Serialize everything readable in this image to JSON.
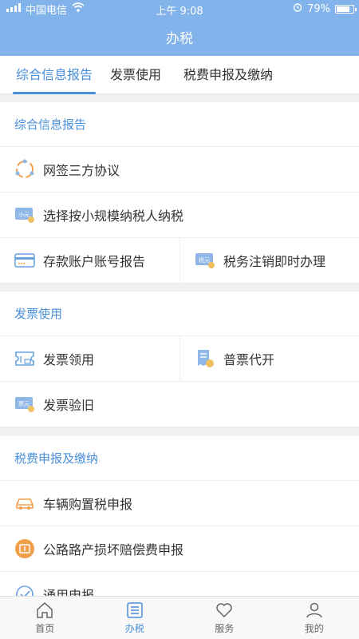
{
  "status_bar": {
    "carrier": "中国电信",
    "time": "上午 9:08",
    "battery": "79%"
  },
  "header": {
    "title": "办税"
  },
  "tabs": [
    {
      "label": "综合信息报告",
      "active": true
    },
    {
      "label": "发票使用",
      "active": false
    },
    {
      "label": "税费申报及缴纳",
      "active": false
    }
  ],
  "sections": {
    "info_report": {
      "title": "综合信息报告",
      "items": {
        "online_agreement": "网签三方协议",
        "small_scale": "选择按小规模纳税人纳税",
        "account_report": "存款账户账号报告",
        "tax_cancel": "税务注销即时办理"
      }
    },
    "invoice": {
      "title": "发票使用",
      "items": {
        "invoice_claim": "发票领用",
        "invoice_issue": "普票代开",
        "invoice_check": "发票验旧"
      }
    },
    "declare": {
      "title": "税费申报及缴纳",
      "items": {
        "vehicle_tax": "车辆购置税申报",
        "road_damage": "公路路产损坏赔偿费申报",
        "general": "通用申报"
      }
    }
  },
  "icon_text": {
    "small": "小元",
    "tax": "税元",
    "ticket": "票元"
  },
  "tabbar": [
    {
      "label": "首页",
      "icon": "home-icon",
      "active": false
    },
    {
      "label": "办税",
      "icon": "list-icon",
      "active": true
    },
    {
      "label": "服务",
      "icon": "heart-icon",
      "active": false
    },
    {
      "label": "我的",
      "icon": "user-icon",
      "active": false
    }
  ],
  "colors": {
    "header": "#82b3ea",
    "accent": "#4a8fd9",
    "orange": "#f0a04b"
  }
}
